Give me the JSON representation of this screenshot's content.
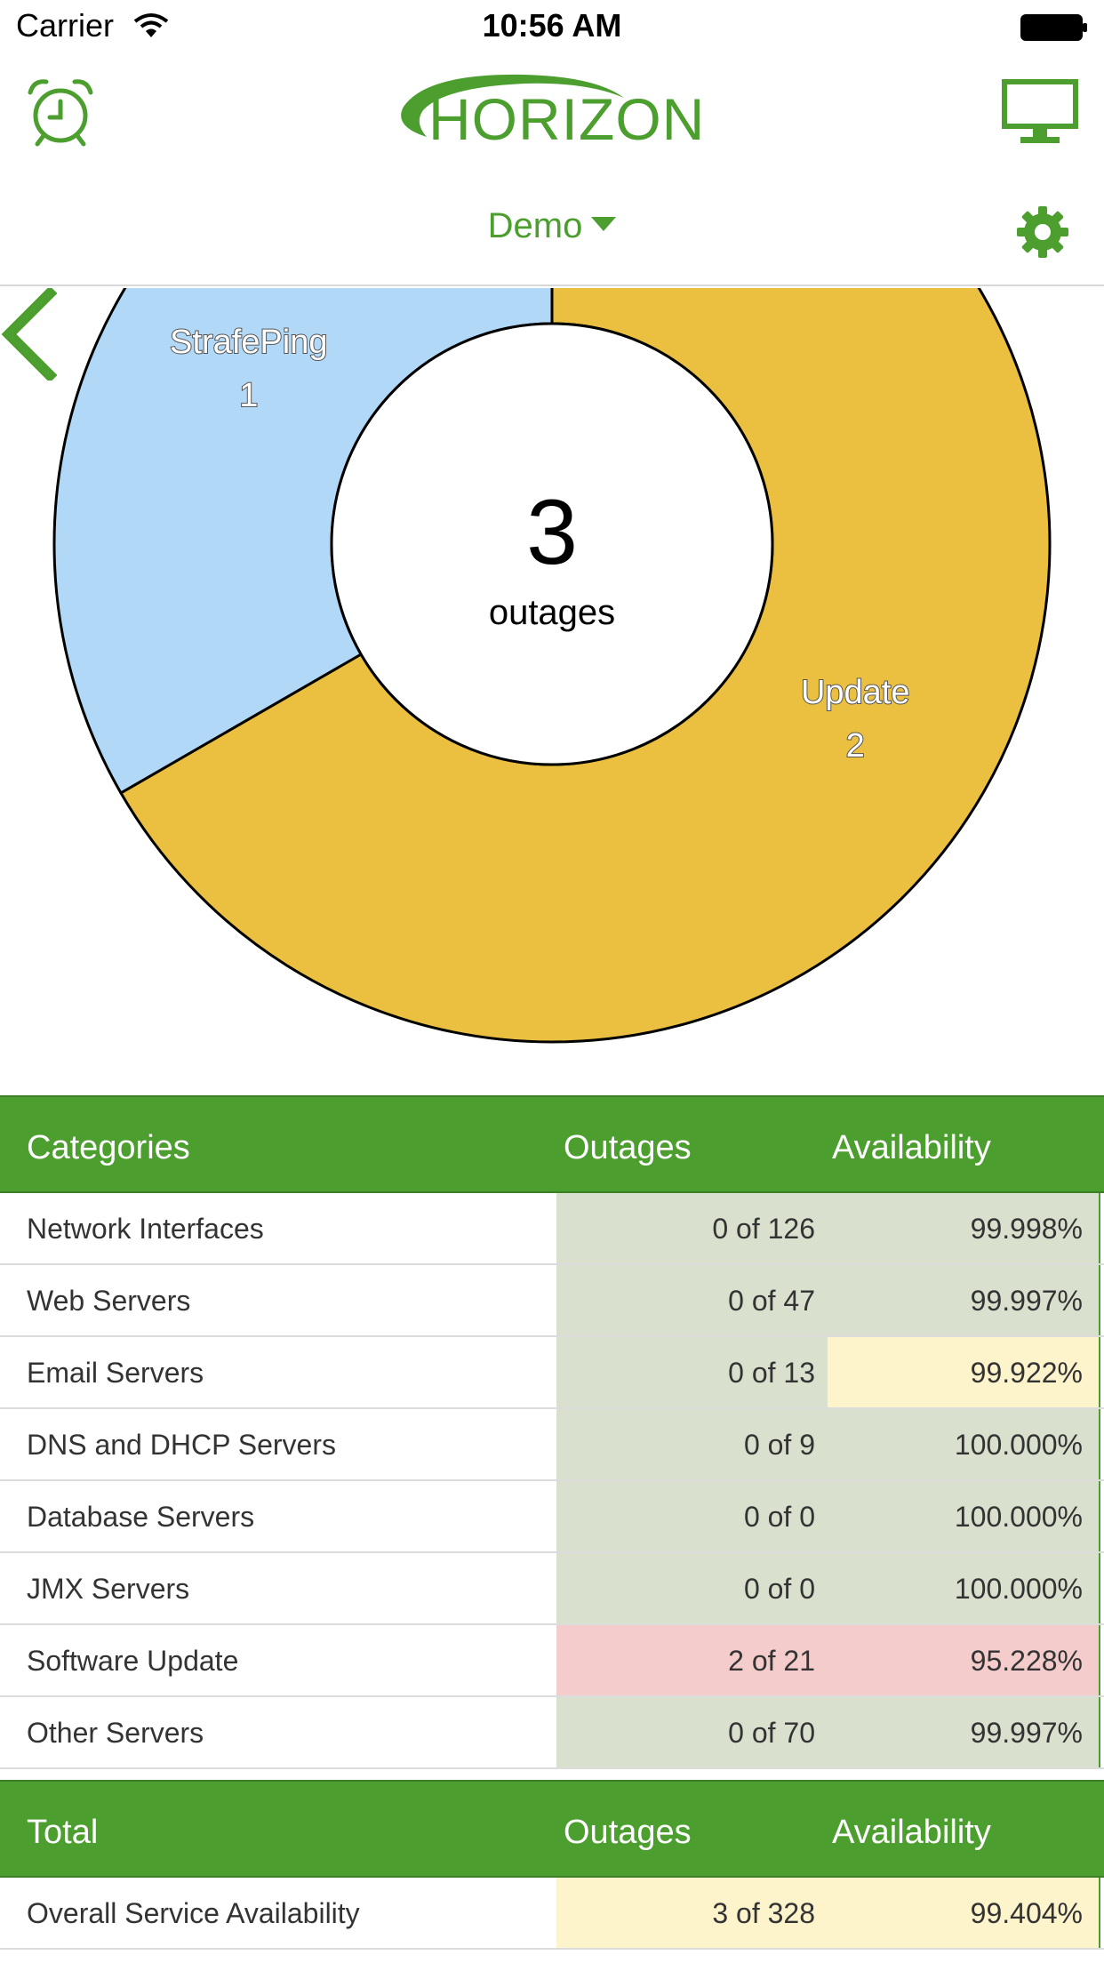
{
  "status_bar": {
    "carrier": "Carrier",
    "time": "10:56 AM"
  },
  "header": {
    "logo_text": "HORIZON",
    "server_selector": "Demo"
  },
  "colors": {
    "brand_green": "#4c9e2f",
    "normal_cell": "#d9e1ce",
    "warning_cell": "#fdf4cc",
    "critical_cell": "#f4cccc",
    "update_slice": "#ebc040",
    "strafeping_slice": "#b1d8f6"
  },
  "chart_data": {
    "type": "pie",
    "center_value": "3",
    "center_label": "outages",
    "slices": [
      {
        "name": "StrafePing",
        "value": 1,
        "color": "#b1d8f6"
      },
      {
        "name": "Update",
        "value": 2,
        "color": "#ebc040"
      }
    ]
  },
  "categories_table": {
    "headers": {
      "category": "Categories",
      "outages": "Outages",
      "availability": "Availability"
    },
    "rows": [
      {
        "name": "Network Interfaces",
        "outages": "0 of 126",
        "availability": "99.998%",
        "outages_status": "normal",
        "availability_status": "normal"
      },
      {
        "name": "Web Servers",
        "outages": "0 of 47",
        "availability": "99.997%",
        "outages_status": "normal",
        "availability_status": "normal"
      },
      {
        "name": "Email Servers",
        "outages": "0 of 13",
        "availability": "99.922%",
        "outages_status": "normal",
        "availability_status": "warning"
      },
      {
        "name": "DNS and DHCP Servers",
        "outages": "0 of 9",
        "availability": "100.000%",
        "outages_status": "normal",
        "availability_status": "normal"
      },
      {
        "name": "Database Servers",
        "outages": "0 of 0",
        "availability": "100.000%",
        "outages_status": "normal",
        "availability_status": "normal"
      },
      {
        "name": "JMX Servers",
        "outages": "0 of 0",
        "availability": "100.000%",
        "outages_status": "normal",
        "availability_status": "normal"
      },
      {
        "name": "Software Update",
        "outages": "2 of 21",
        "availability": "95.228%",
        "outages_status": "critical",
        "availability_status": "critical"
      },
      {
        "name": "Other Servers",
        "outages": "0 of 70",
        "availability": "99.997%",
        "outages_status": "normal",
        "availability_status": "normal"
      }
    ]
  },
  "total_table": {
    "headers": {
      "category": "Total",
      "outages": "Outages",
      "availability": "Availability"
    },
    "rows": [
      {
        "name": "Overall Service Availability",
        "outages": "3 of 328",
        "availability": "99.404%",
        "outages_status": "warning",
        "availability_status": "warning"
      }
    ]
  }
}
